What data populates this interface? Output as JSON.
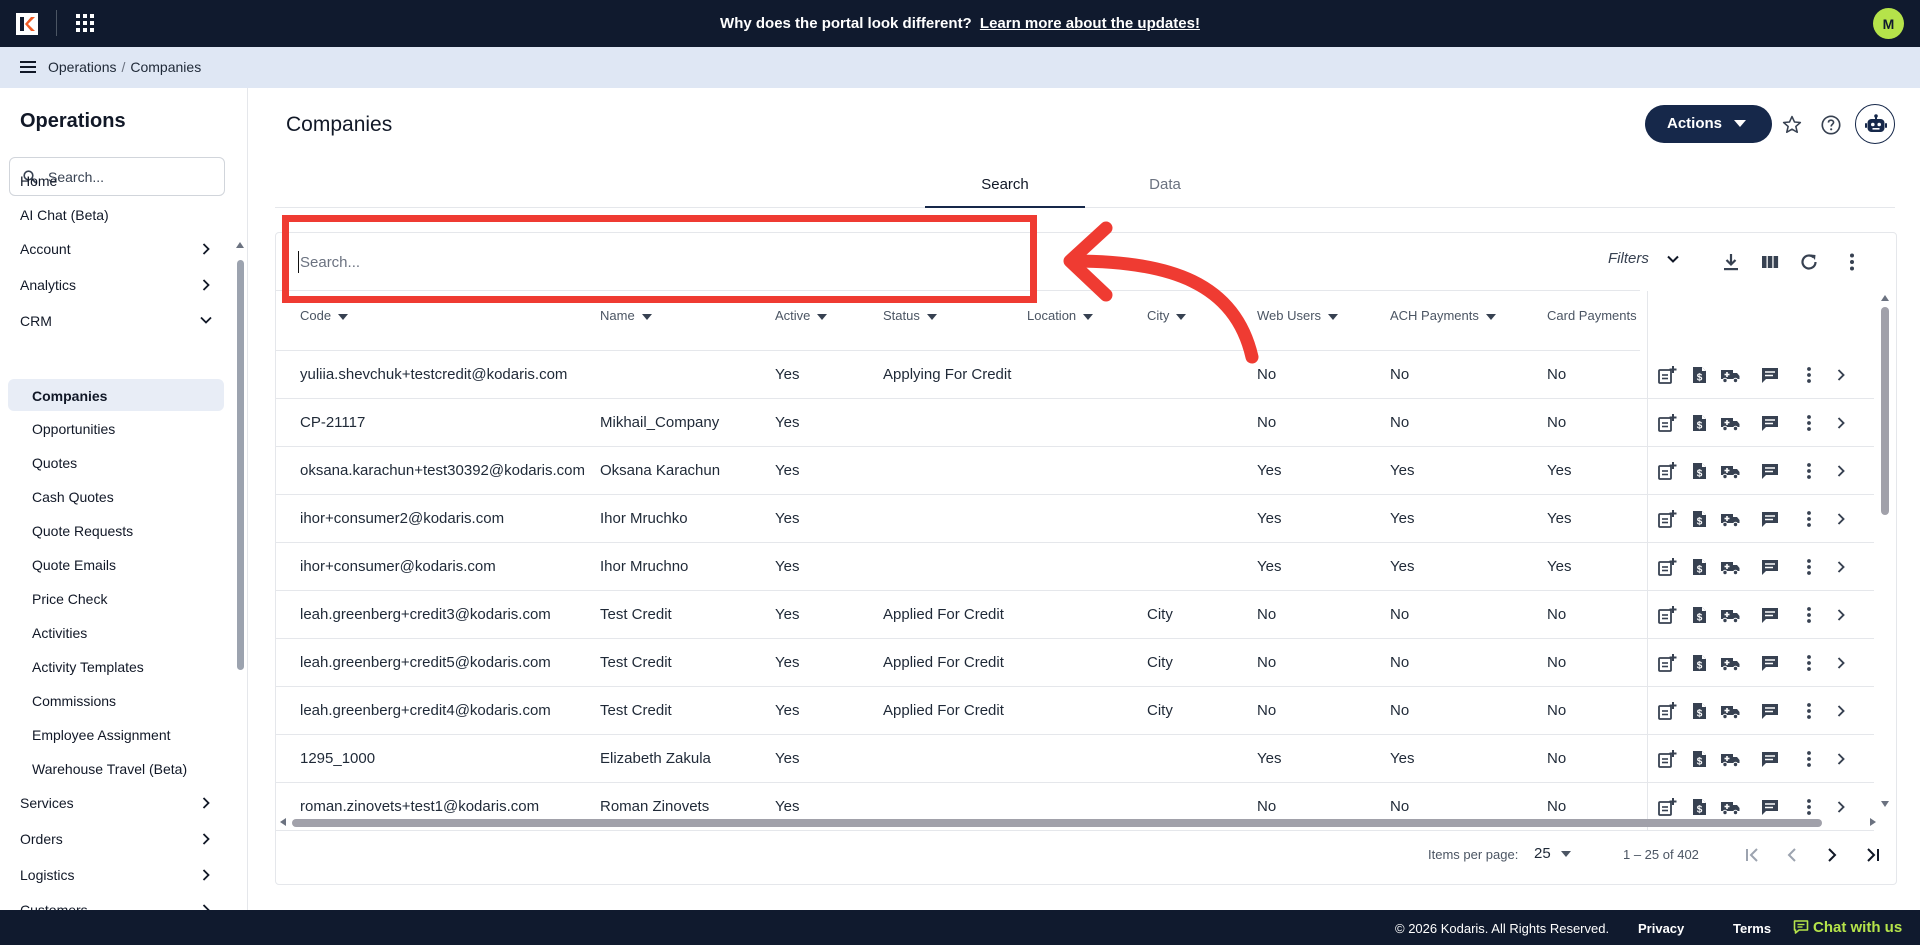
{
  "topbar": {
    "banner_text": "Why does the portal look different?",
    "banner_link": "Learn more about the updates!",
    "avatar_initial": "M"
  },
  "breadcrumb": [
    "Operations",
    "Companies"
  ],
  "sidebar": {
    "title": "Operations",
    "search_placeholder": "Search...",
    "items": [
      {
        "label": "Home"
      },
      {
        "label": "AI Chat (Beta)"
      },
      {
        "label": "Account"
      },
      {
        "label": "Analytics"
      },
      {
        "label": "CRM"
      },
      {
        "label": "Companies"
      },
      {
        "label": "Opportunities"
      },
      {
        "label": "Quotes"
      },
      {
        "label": "Cash Quotes"
      },
      {
        "label": "Quote Requests"
      },
      {
        "label": "Quote Emails"
      },
      {
        "label": "Price Check"
      },
      {
        "label": "Activities"
      },
      {
        "label": "Activity Templates"
      },
      {
        "label": "Commissions"
      },
      {
        "label": "Employee Assignment"
      },
      {
        "label": "Warehouse Travel (Beta)"
      },
      {
        "label": "Services"
      },
      {
        "label": "Orders"
      },
      {
        "label": "Logistics"
      },
      {
        "label": "Customers"
      }
    ]
  },
  "header": {
    "title": "Companies",
    "actions_label": "Actions"
  },
  "tabs": [
    "Search",
    "Data"
  ],
  "table": {
    "search_placeholder": "Search...",
    "filters_label": "Filters",
    "columns": [
      "Code",
      "Name",
      "Active",
      "Status",
      "Location",
      "City",
      "Web Users",
      "ACH Payments",
      "Card Payments"
    ],
    "rows": [
      [
        "yuliia.shevchuk+testcredit@kodaris.com",
        "",
        "Yes",
        "Applying For Credit",
        "",
        "",
        "No",
        "No",
        "No"
      ],
      [
        "CP-21117",
        "Mikhail_Company",
        "Yes",
        "",
        "",
        "",
        "No",
        "No",
        "No"
      ],
      [
        "oksana.karachun+test30392@kodaris.com",
        "Oksana Karachun",
        "Yes",
        "",
        "",
        "",
        "Yes",
        "Yes",
        "Yes"
      ],
      [
        "ihor+consumer2@kodaris.com",
        "Ihor Mruchko",
        "Yes",
        "",
        "",
        "",
        "Yes",
        "Yes",
        "Yes"
      ],
      [
        "ihor+consumer@kodaris.com",
        "Ihor Mruchno",
        "Yes",
        "",
        "",
        "",
        "Yes",
        "Yes",
        "Yes"
      ],
      [
        "leah.greenberg+credit3@kodaris.com",
        "Test Credit",
        "Yes",
        "Applied For Credit",
        "",
        "City",
        "No",
        "No",
        "No"
      ],
      [
        "leah.greenberg+credit5@kodaris.com",
        "Test Credit",
        "Yes",
        "Applied For Credit",
        "",
        "City",
        "No",
        "No",
        "No"
      ],
      [
        "leah.greenberg+credit4@kodaris.com",
        "Test Credit",
        "Yes",
        "Applied For Credit",
        "",
        "City",
        "No",
        "No",
        "No"
      ],
      [
        "1295_1000",
        "Elizabeth Zakula",
        "Yes",
        "",
        "",
        "",
        "Yes",
        "Yes",
        "No"
      ],
      [
        "roman.zinovets+test1@kodaris.com",
        "Roman Zinovets",
        "Yes",
        "",
        "",
        "",
        "No",
        "No",
        "No"
      ]
    ]
  },
  "pager": {
    "items_per_page_label": "Items per page:",
    "items_per_page": "25",
    "range": "1 – 25 of 402"
  },
  "footer": {
    "copyright": "© 2026 Kodaris. All Rights Reserved.",
    "privacy": "Privacy",
    "terms": "Terms",
    "chat": "Chat with us"
  },
  "colors": {
    "navy": "#101a2e",
    "primary": "#16284a",
    "accent": "#b5e34a",
    "annotation": "#ef3b32"
  }
}
